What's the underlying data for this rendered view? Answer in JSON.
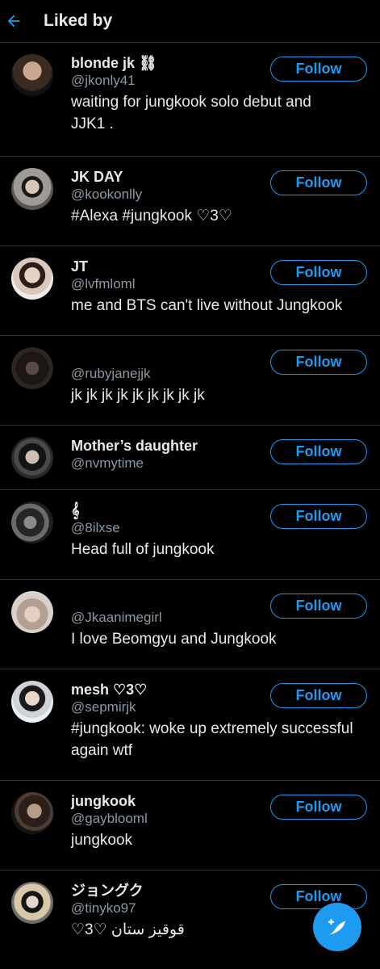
{
  "header": {
    "title": "Liked by"
  },
  "users": [
    {
      "name": "blonde jk ⛓",
      "handle": "@jkonly41",
      "bio": "waiting for jungkook solo debut and JJK1 .",
      "follow_label": "Follow"
    },
    {
      "name": "JK DAY",
      "handle": "@kookonlly",
      "bio": "#Alexa #jungkook ♡3♡",
      "follow_label": "Follow"
    },
    {
      "name": "JT",
      "handle": "@lvfmloml",
      "bio": "me and BTS can't live without Jungkook",
      "follow_label": "Follow"
    },
    {
      "name": "",
      "handle": "@rubyjanejjk",
      "bio": "jk jk jk jk jk jk jk jk jk",
      "follow_label": "Follow"
    },
    {
      "name": "Mother’s daughter",
      "handle": "@nvmytime",
      "bio": "",
      "follow_label": "Follow"
    },
    {
      "name": "𝄞",
      "handle": "@8ilxse",
      "bio": "Head full of jungkook",
      "follow_label": "Follow"
    },
    {
      "name": "",
      "handle": "@Jkaanimegirl",
      "bio": "I love Beomgyu and Jungkook",
      "follow_label": "Follow"
    },
    {
      "name": "mesh ♡3♡",
      "handle": "@sepmirjk",
      "bio": "#jungkook: woke up extremely successful again wtf",
      "follow_label": "Follow"
    },
    {
      "name": "jungkook",
      "handle": "@gayblooml",
      "bio": "jungkook",
      "follow_label": "Follow"
    },
    {
      "name": "ジョングク",
      "handle": "@tinyko97",
      "bio": "♡3♡ قوقيز ستان",
      "follow_label": "Follow"
    }
  ],
  "colors": {
    "accent": "#1d9bf0",
    "background": "#000000",
    "divider": "#2f3336",
    "secondary_text": "#8b98a5"
  },
  "icons": {
    "back": "arrow-left-icon",
    "compose": "compose-tweet-icon"
  }
}
